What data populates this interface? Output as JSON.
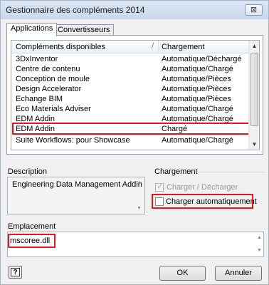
{
  "window": {
    "title": "Gestionnaire des compléments 2014",
    "close_glyph": "⊠"
  },
  "tabs": [
    {
      "label": "Applications",
      "active": true
    },
    {
      "label": "Convertisseurs",
      "active": false
    }
  ],
  "list": {
    "columns": [
      "Compléments disponibles",
      "Chargement"
    ],
    "sort_glyph": "/",
    "rows": [
      {
        "name": "3DxInventor",
        "loading": "Automatique/Déchargé"
      },
      {
        "name": "Centre de contenu",
        "loading": "Automatique/Chargé"
      },
      {
        "name": "Conception de moule",
        "loading": "Automatique/Pièces"
      },
      {
        "name": "Design Accelerator",
        "loading": "Automatique/Pièces"
      },
      {
        "name": "Echange BIM",
        "loading": "Automatique/Pièces"
      },
      {
        "name": "Eco Materials Adviser",
        "loading": "Automatique/Chargé"
      },
      {
        "name": "EDM Addin",
        "loading": "Automatique/Chargé"
      },
      {
        "name": "EDM Addin",
        "loading": "Chargé",
        "selected": true
      },
      {
        "name": "Suite Workflows: pour Showcase",
        "loading": "Automatique/Chargé"
      }
    ],
    "scroll_up_glyph": "▲",
    "scroll_down_glyph": "▼"
  },
  "description": {
    "label": "Description",
    "text": "Engineering Data Management Addin",
    "scroll_up_glyph": "▲",
    "scroll_down_glyph": "▼"
  },
  "loading_group": {
    "label": "Chargement",
    "load_unload_label": "Charger / Décharger",
    "load_unload_checked": true,
    "load_unload_enabled": false,
    "auto_load_label": "Charger automatiquement",
    "auto_load_checked": false,
    "tick_glyph": "✓"
  },
  "location": {
    "label": "Emplacement",
    "value": "mscoree.dll",
    "scroll_up_glyph": "▲",
    "scroll_down_glyph": "▼"
  },
  "buttons": {
    "help_glyph": "?",
    "ok": "OK",
    "cancel": "Annuler"
  },
  "colors": {
    "highlight": "#e8141f"
  }
}
